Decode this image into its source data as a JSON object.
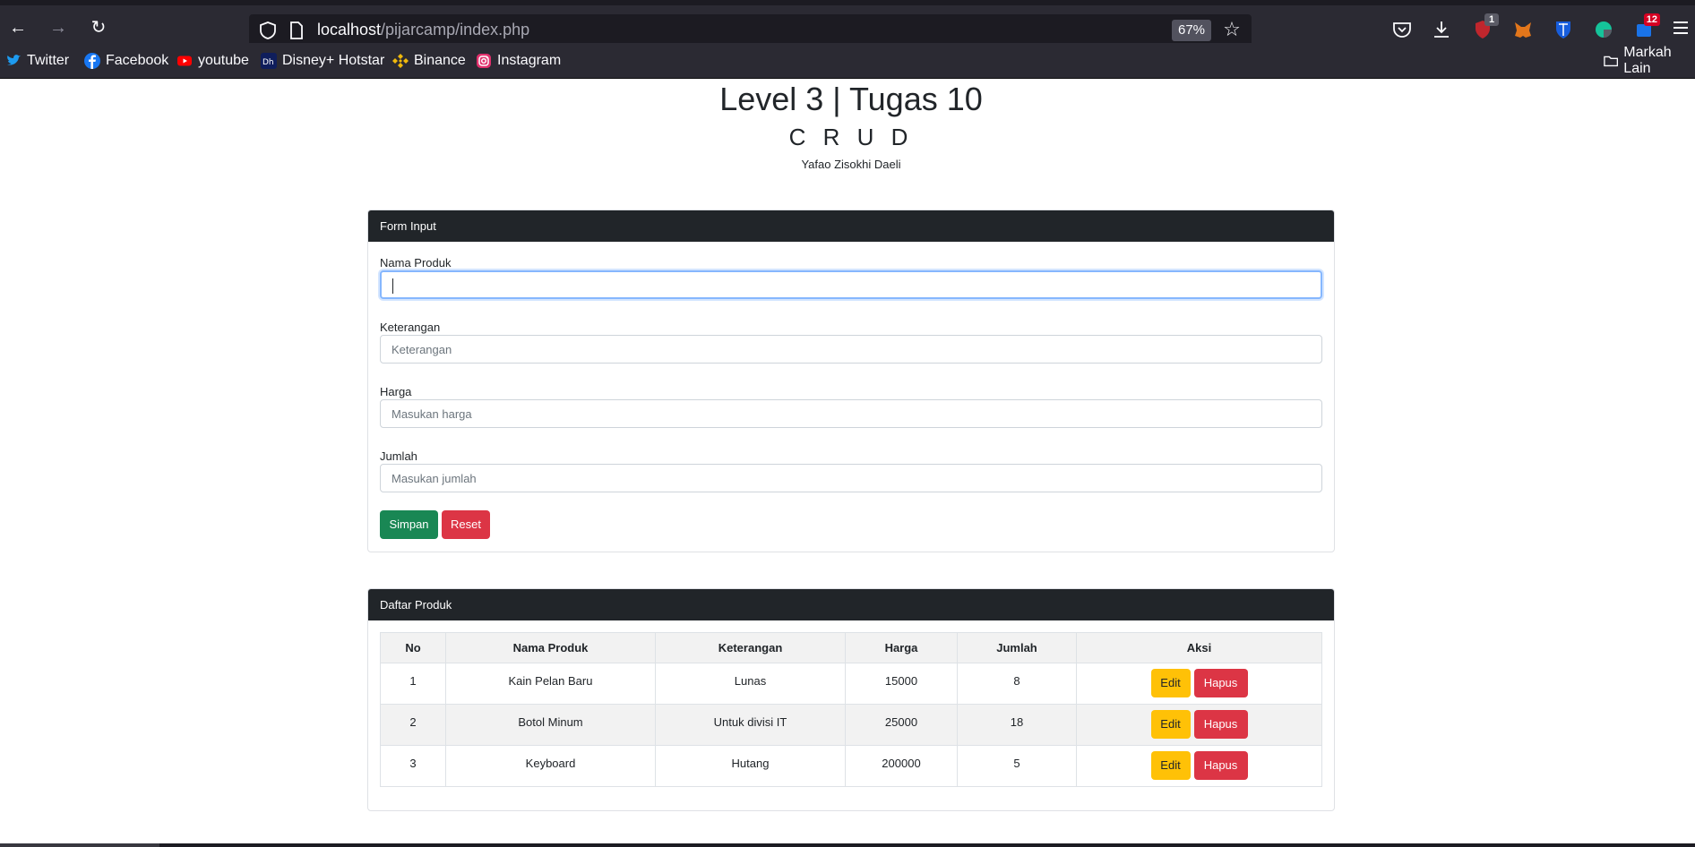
{
  "browser": {
    "url_host": "localhost",
    "url_path": "/pijarcamp/index.php",
    "zoom": "67%",
    "badges": {
      "ublock": "1",
      "extension": "12"
    },
    "other_bookmarks": "Markah Lain",
    "bookmarks": [
      {
        "label": "Twitter",
        "icon": "twitter-icon",
        "color": "#1d9bf0"
      },
      {
        "label": "Facebook",
        "icon": "facebook-icon",
        "color": "#1877f2"
      },
      {
        "label": "youtube",
        "icon": "youtube-icon",
        "color": "#ff0000"
      },
      {
        "label": "Disney+ Hotstar",
        "icon": "hotstar-icon",
        "color": "#0f1e5c"
      },
      {
        "label": "Binance",
        "icon": "binance-icon",
        "color": "#f0b90b"
      },
      {
        "label": "Instagram",
        "icon": "instagram-icon",
        "color": "#e1306c"
      }
    ]
  },
  "header": {
    "title": "Level 3 | Tugas 10",
    "subtitle": "C R U D",
    "author": "Yafao Zisokhi Daeli"
  },
  "form": {
    "header": "Form Input",
    "fields": [
      {
        "label": "Nama Produk",
        "placeholder": "",
        "value": ""
      },
      {
        "label": "Keterangan",
        "placeholder": "Keterangan",
        "value": ""
      },
      {
        "label": "Harga",
        "placeholder": "Masukan harga",
        "value": ""
      },
      {
        "label": "Jumlah",
        "placeholder": "Masukan jumlah",
        "value": ""
      }
    ],
    "save_label": "Simpan",
    "reset_label": "Reset"
  },
  "list": {
    "header": "Daftar Produk",
    "columns": [
      "No",
      "Nama Produk",
      "Keterangan",
      "Harga",
      "Jumlah",
      "Aksi"
    ],
    "edit_label": "Edit",
    "delete_label": "Hapus",
    "rows": [
      {
        "no": "1",
        "nama": "Kain Pelan Baru",
        "keterangan": "Lunas",
        "harga": "15000",
        "jumlah": "8"
      },
      {
        "no": "2",
        "nama": "Botol Minum",
        "keterangan": "Untuk divisi IT",
        "harga": "25000",
        "jumlah": "18"
      },
      {
        "no": "3",
        "nama": "Keyboard",
        "keterangan": "Hutang",
        "harga": "200000",
        "jumlah": "5"
      }
    ]
  }
}
